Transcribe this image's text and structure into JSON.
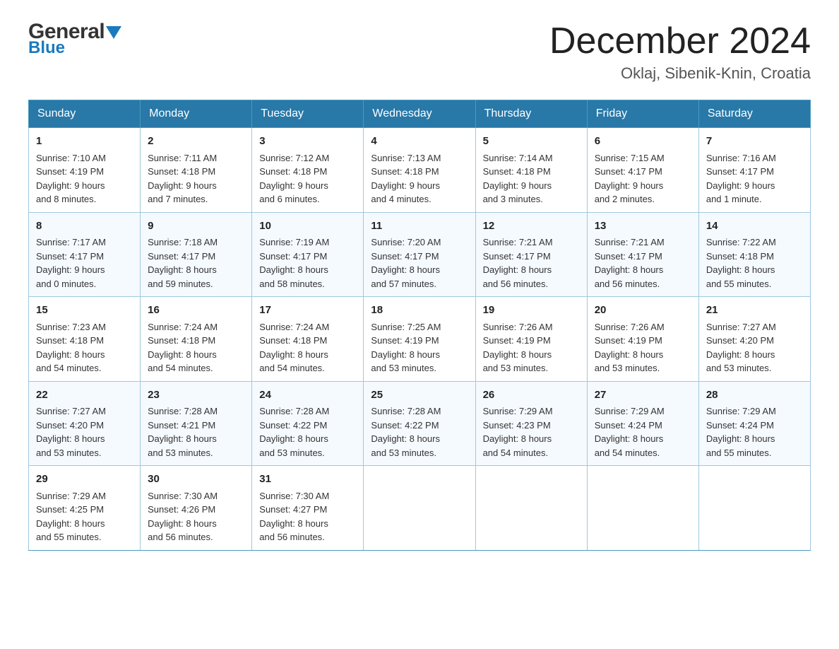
{
  "header": {
    "logo_general": "General",
    "logo_blue": "Blue",
    "month_title": "December 2024",
    "location": "Oklaj, Sibenik-Knin, Croatia"
  },
  "calendar": {
    "days_of_week": [
      "Sunday",
      "Monday",
      "Tuesday",
      "Wednesday",
      "Thursday",
      "Friday",
      "Saturday"
    ],
    "weeks": [
      [
        {
          "day": "1",
          "sunrise": "Sunrise: 7:10 AM",
          "sunset": "Sunset: 4:19 PM",
          "daylight": "Daylight: 9 hours",
          "daylight2": "and 8 minutes."
        },
        {
          "day": "2",
          "sunrise": "Sunrise: 7:11 AM",
          "sunset": "Sunset: 4:18 PM",
          "daylight": "Daylight: 9 hours",
          "daylight2": "and 7 minutes."
        },
        {
          "day": "3",
          "sunrise": "Sunrise: 7:12 AM",
          "sunset": "Sunset: 4:18 PM",
          "daylight": "Daylight: 9 hours",
          "daylight2": "and 6 minutes."
        },
        {
          "day": "4",
          "sunrise": "Sunrise: 7:13 AM",
          "sunset": "Sunset: 4:18 PM",
          "daylight": "Daylight: 9 hours",
          "daylight2": "and 4 minutes."
        },
        {
          "day": "5",
          "sunrise": "Sunrise: 7:14 AM",
          "sunset": "Sunset: 4:18 PM",
          "daylight": "Daylight: 9 hours",
          "daylight2": "and 3 minutes."
        },
        {
          "day": "6",
          "sunrise": "Sunrise: 7:15 AM",
          "sunset": "Sunset: 4:17 PM",
          "daylight": "Daylight: 9 hours",
          "daylight2": "and 2 minutes."
        },
        {
          "day": "7",
          "sunrise": "Sunrise: 7:16 AM",
          "sunset": "Sunset: 4:17 PM",
          "daylight": "Daylight: 9 hours",
          "daylight2": "and 1 minute."
        }
      ],
      [
        {
          "day": "8",
          "sunrise": "Sunrise: 7:17 AM",
          "sunset": "Sunset: 4:17 PM",
          "daylight": "Daylight: 9 hours",
          "daylight2": "and 0 minutes."
        },
        {
          "day": "9",
          "sunrise": "Sunrise: 7:18 AM",
          "sunset": "Sunset: 4:17 PM",
          "daylight": "Daylight: 8 hours",
          "daylight2": "and 59 minutes."
        },
        {
          "day": "10",
          "sunrise": "Sunrise: 7:19 AM",
          "sunset": "Sunset: 4:17 PM",
          "daylight": "Daylight: 8 hours",
          "daylight2": "and 58 minutes."
        },
        {
          "day": "11",
          "sunrise": "Sunrise: 7:20 AM",
          "sunset": "Sunset: 4:17 PM",
          "daylight": "Daylight: 8 hours",
          "daylight2": "and 57 minutes."
        },
        {
          "day": "12",
          "sunrise": "Sunrise: 7:21 AM",
          "sunset": "Sunset: 4:17 PM",
          "daylight": "Daylight: 8 hours",
          "daylight2": "and 56 minutes."
        },
        {
          "day": "13",
          "sunrise": "Sunrise: 7:21 AM",
          "sunset": "Sunset: 4:17 PM",
          "daylight": "Daylight: 8 hours",
          "daylight2": "and 56 minutes."
        },
        {
          "day": "14",
          "sunrise": "Sunrise: 7:22 AM",
          "sunset": "Sunset: 4:18 PM",
          "daylight": "Daylight: 8 hours",
          "daylight2": "and 55 minutes."
        }
      ],
      [
        {
          "day": "15",
          "sunrise": "Sunrise: 7:23 AM",
          "sunset": "Sunset: 4:18 PM",
          "daylight": "Daylight: 8 hours",
          "daylight2": "and 54 minutes."
        },
        {
          "day": "16",
          "sunrise": "Sunrise: 7:24 AM",
          "sunset": "Sunset: 4:18 PM",
          "daylight": "Daylight: 8 hours",
          "daylight2": "and 54 minutes."
        },
        {
          "day": "17",
          "sunrise": "Sunrise: 7:24 AM",
          "sunset": "Sunset: 4:18 PM",
          "daylight": "Daylight: 8 hours",
          "daylight2": "and 54 minutes."
        },
        {
          "day": "18",
          "sunrise": "Sunrise: 7:25 AM",
          "sunset": "Sunset: 4:19 PM",
          "daylight": "Daylight: 8 hours",
          "daylight2": "and 53 minutes."
        },
        {
          "day": "19",
          "sunrise": "Sunrise: 7:26 AM",
          "sunset": "Sunset: 4:19 PM",
          "daylight": "Daylight: 8 hours",
          "daylight2": "and 53 minutes."
        },
        {
          "day": "20",
          "sunrise": "Sunrise: 7:26 AM",
          "sunset": "Sunset: 4:19 PM",
          "daylight": "Daylight: 8 hours",
          "daylight2": "and 53 minutes."
        },
        {
          "day": "21",
          "sunrise": "Sunrise: 7:27 AM",
          "sunset": "Sunset: 4:20 PM",
          "daylight": "Daylight: 8 hours",
          "daylight2": "and 53 minutes."
        }
      ],
      [
        {
          "day": "22",
          "sunrise": "Sunrise: 7:27 AM",
          "sunset": "Sunset: 4:20 PM",
          "daylight": "Daylight: 8 hours",
          "daylight2": "and 53 minutes."
        },
        {
          "day": "23",
          "sunrise": "Sunrise: 7:28 AM",
          "sunset": "Sunset: 4:21 PM",
          "daylight": "Daylight: 8 hours",
          "daylight2": "and 53 minutes."
        },
        {
          "day": "24",
          "sunrise": "Sunrise: 7:28 AM",
          "sunset": "Sunset: 4:22 PM",
          "daylight": "Daylight: 8 hours",
          "daylight2": "and 53 minutes."
        },
        {
          "day": "25",
          "sunrise": "Sunrise: 7:28 AM",
          "sunset": "Sunset: 4:22 PM",
          "daylight": "Daylight: 8 hours",
          "daylight2": "and 53 minutes."
        },
        {
          "day": "26",
          "sunrise": "Sunrise: 7:29 AM",
          "sunset": "Sunset: 4:23 PM",
          "daylight": "Daylight: 8 hours",
          "daylight2": "and 54 minutes."
        },
        {
          "day": "27",
          "sunrise": "Sunrise: 7:29 AM",
          "sunset": "Sunset: 4:24 PM",
          "daylight": "Daylight: 8 hours",
          "daylight2": "and 54 minutes."
        },
        {
          "day": "28",
          "sunrise": "Sunrise: 7:29 AM",
          "sunset": "Sunset: 4:24 PM",
          "daylight": "Daylight: 8 hours",
          "daylight2": "and 55 minutes."
        }
      ],
      [
        {
          "day": "29",
          "sunrise": "Sunrise: 7:29 AM",
          "sunset": "Sunset: 4:25 PM",
          "daylight": "Daylight: 8 hours",
          "daylight2": "and 55 minutes."
        },
        {
          "day": "30",
          "sunrise": "Sunrise: 7:30 AM",
          "sunset": "Sunset: 4:26 PM",
          "daylight": "Daylight: 8 hours",
          "daylight2": "and 56 minutes."
        },
        {
          "day": "31",
          "sunrise": "Sunrise: 7:30 AM",
          "sunset": "Sunset: 4:27 PM",
          "daylight": "Daylight: 8 hours",
          "daylight2": "and 56 minutes."
        },
        {
          "day": "",
          "sunrise": "",
          "sunset": "",
          "daylight": "",
          "daylight2": ""
        },
        {
          "day": "",
          "sunrise": "",
          "sunset": "",
          "daylight": "",
          "daylight2": ""
        },
        {
          "day": "",
          "sunrise": "",
          "sunset": "",
          "daylight": "",
          "daylight2": ""
        },
        {
          "day": "",
          "sunrise": "",
          "sunset": "",
          "daylight": "",
          "daylight2": ""
        }
      ]
    ]
  }
}
